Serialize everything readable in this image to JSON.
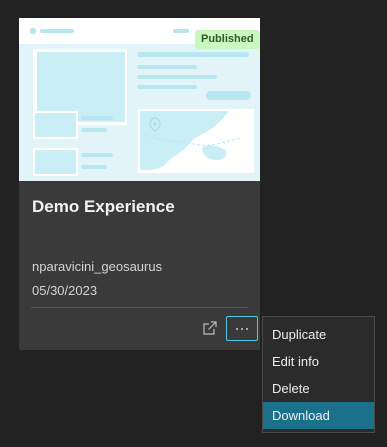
{
  "card": {
    "badge": "Published",
    "title": "Demo Experience",
    "owner": "nparavicini_geosaurus",
    "date": "05/30/2023"
  },
  "actions": {
    "open_icon": "open-external-icon",
    "more_icon": "more-horizontal-icon"
  },
  "menu": {
    "items": [
      {
        "label": "Duplicate"
      },
      {
        "label": "Edit info"
      },
      {
        "label": "Delete"
      },
      {
        "label": "Download",
        "highlighted": true
      }
    ]
  },
  "colors": {
    "badge_bg": "#c9f7c0",
    "accent": "#4fc6ea",
    "menu_highlight": "#1b7189"
  }
}
